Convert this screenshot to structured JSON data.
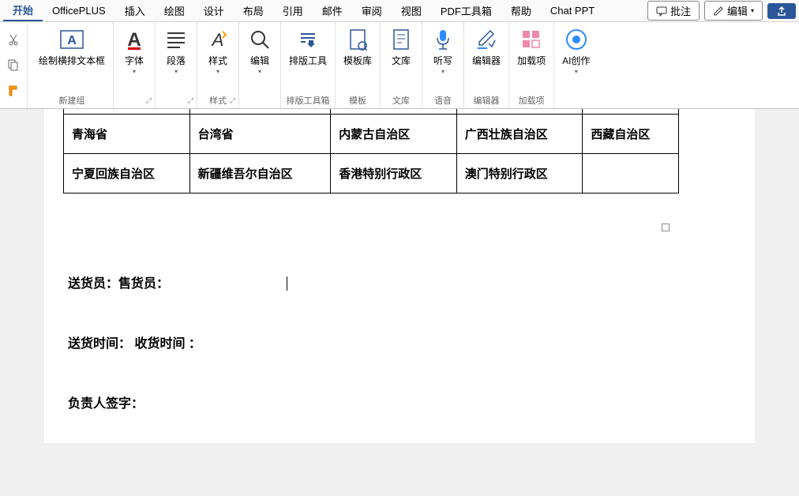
{
  "menubar": {
    "items": [
      "开始",
      "OfficePLUS",
      "插入",
      "绘图",
      "设计",
      "布局",
      "引用",
      "邮件",
      "审阅",
      "视图",
      "PDF工具箱",
      "帮助",
      "Chat PPT"
    ],
    "comment": "批注",
    "edit": "编辑"
  },
  "ribbon": {
    "newgroup": {
      "label": "新建组",
      "textbox": "绘制横排文本框"
    },
    "font": "字体",
    "paragraph": "段落",
    "styles": {
      "group": "样式",
      "btn": "样式"
    },
    "edit": "编辑",
    "layout_tools": {
      "group": "排版工具箱",
      "btn": "排版工具"
    },
    "template": {
      "group": "模板",
      "btn": "模板库"
    },
    "wenku": {
      "group": "文库",
      "btn": "文库"
    },
    "voice": {
      "group": "语音",
      "btn": "听写"
    },
    "editor": {
      "group": "编辑器",
      "btn": "编辑器"
    },
    "addin": {
      "group": "加载项",
      "btn": "加载项"
    },
    "ai": "AI创作"
  },
  "table": {
    "row1": [
      "青海省",
      "台湾省",
      "内蒙古自治区",
      "广西壮族自治区",
      "西藏自治区"
    ],
    "row2": [
      "宁夏回族自治区",
      "新疆维吾尔自治区",
      "香港特别行政区",
      "澳门特别行政区",
      ""
    ]
  },
  "doc": {
    "line1": "送货员：售货员：",
    "line2": "送货时间： 收货时间  ：",
    "line3": "负责人签字："
  }
}
